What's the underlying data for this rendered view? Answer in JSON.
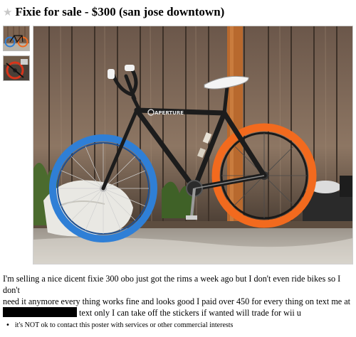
{
  "posting": {
    "title": "Fixie for sale - $300 (san jose downtown)",
    "favorite_icon": "star-icon"
  },
  "photo": {
    "frame_brand": "APERTURE"
  },
  "description": {
    "line1": "I'm selling a nice dicent fixie 300 obo just got the rims a week ago but I don't even ride bikes so I don't",
    "line2": "need it anymore every thing works fine and looks good I paid over 450 for every thing on text me at",
    "line3_after_redaction": "text only I can take off the stickers if wanted will trade for wii u"
  },
  "notices": [
    "it's NOT ok to contact this poster with services or other commercial interests"
  ],
  "colors": {
    "front_rim": "#2f7fd6",
    "rear_rim": "#f26a1e",
    "frame": "#1c1c1c",
    "fence": "#8a6c55"
  }
}
